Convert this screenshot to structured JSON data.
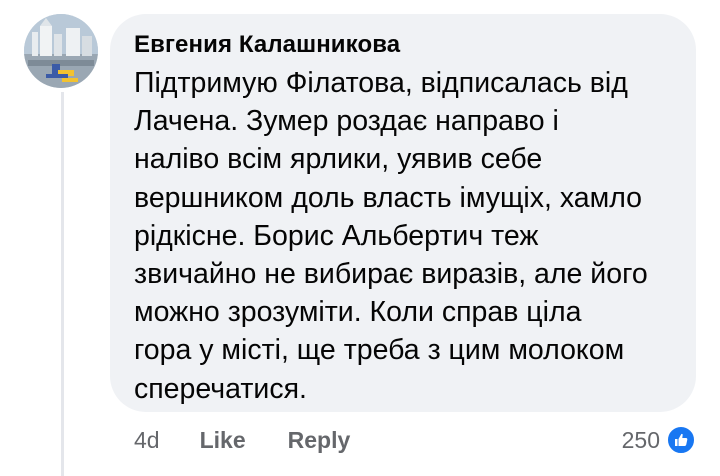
{
  "comment": {
    "author": "Евгения Калашникова",
    "text_lines": [
      "Підтримую Філатова, відписалась від",
      "Лачена. Зумер роздає направо і",
      "наліво всім ярлики, уявив себе",
      "вершником доль власть імущіх, хамло",
      "рідкісне. Борис Альбертич теж",
      "звичайно не вибирає виразів, але його",
      "можно зрозуміти. Коли справ ціла",
      "гора у місті, ще треба з цим молоком",
      "сперечатися."
    ]
  },
  "actions": {
    "timestamp": "4d",
    "like_label": "Like",
    "reply_label": "Reply"
  },
  "reactions": {
    "count": "250",
    "icon": "thumbs-up-icon",
    "icon_color": "#1877f2"
  },
  "colors": {
    "bubble_background": "#f0f2f5",
    "text": "#050505",
    "secondary_text": "#65676b",
    "thread_line": "#e4e6eb"
  }
}
